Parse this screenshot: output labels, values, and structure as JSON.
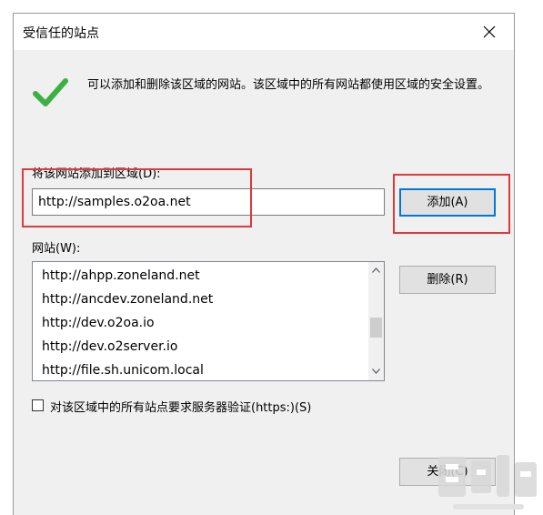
{
  "window": {
    "title": "受信任的站点",
    "close_icon": "close-icon"
  },
  "intro": {
    "icon": "checkmark-icon",
    "text": "可以添加和删除该区域的网站。该区域中的所有网站都使用区域的安全设置。"
  },
  "add_section": {
    "label": "将该网站添加到区域(D):",
    "input_value": "http://samples.o2oa.net",
    "add_button": "添加(A)"
  },
  "sites": {
    "label": "网站(W):",
    "items": [
      "http://ahpp.zoneland.net",
      "http://ancdev.zoneland.net",
      "http://dev.o2oa.io",
      "http://dev.o2server.io",
      "http://file.sh.unicom.local"
    ],
    "remove_button": "删除(R)"
  },
  "https_checkbox": {
    "label": "对该区域中的所有站点要求服务器验证(https:)(S)",
    "checked": false
  },
  "close_button": "关闭(C)",
  "annotations": {
    "highlight_color": "#e0383c"
  },
  "colors": {
    "focus_border": "#0078d7",
    "check_green": "#3cb043"
  }
}
